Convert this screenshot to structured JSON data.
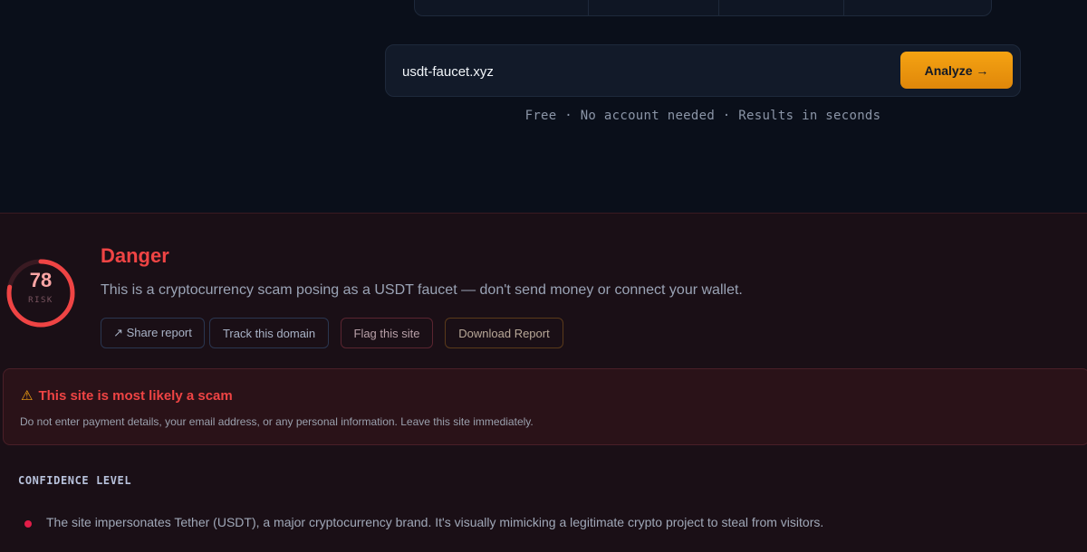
{
  "search": {
    "value": "usdt-faucet.xyz",
    "button_label": "Analyze →"
  },
  "tagline": "Free · No account needed · Results in seconds",
  "result": {
    "score": "78",
    "score_label": "RISK",
    "risk_fraction": 0.78,
    "verdict": "Danger",
    "description": "This is a cryptocurrency scam posing as a USDT faucet — don't send money or connect your wallet.",
    "actions": {
      "share": "↗ Share report",
      "track": "Track this domain",
      "flag": "Flag this site",
      "download": "Download Report"
    }
  },
  "alert": {
    "icon": "warning-icon",
    "title": "This site is most likely a scam",
    "text": "Do not enter payment details, your email address, or any personal information. Leave this site immediately."
  },
  "confidence": {
    "heading": "CONFIDENCE LEVEL",
    "items": [
      "The site impersonates Tether (USDT), a major cryptocurrency brand. It's visually mimicking a legitimate crypto project to steal from visitors."
    ]
  },
  "colors": {
    "danger": "#ef4444",
    "accent": "#f5a312",
    "background": "#0a0f1a"
  }
}
